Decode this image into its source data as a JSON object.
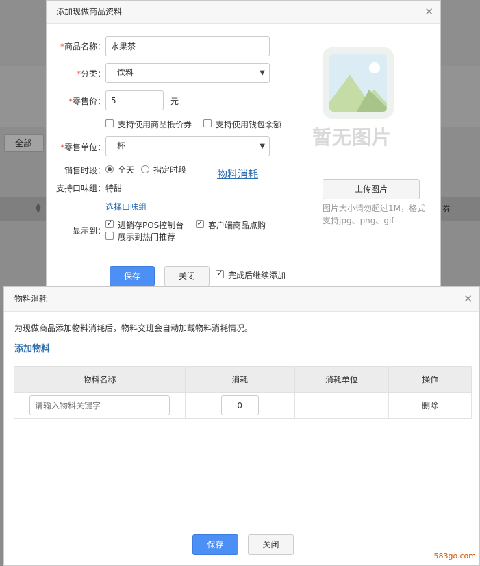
{
  "background": {
    "filter_label": "全部",
    "sort_icon": "sort-icon",
    "column_partial": "券"
  },
  "dialog1": {
    "title": "添加现做商品资料",
    "close_icon": "close-icon",
    "required_mark": "*",
    "name_label": "商品名称：",
    "name_value": "水果茶",
    "category_label": "分类：",
    "category_value": "饮料",
    "price_label": "零售价：",
    "price_value": "5",
    "price_unit": "元",
    "support_voucher": "支持使用商品抵价券",
    "support_wallet": "支持使用钱包余额",
    "unit_label": "零售单位：",
    "unit_value": "杯",
    "sale_time_label": "销售时段：",
    "sale_time_all": "全天",
    "sale_time_custom": "指定时段",
    "material_link": "物料消耗",
    "taste_label": "支持口味组：",
    "taste_value": "特甜",
    "taste_select_link": "选择口味组",
    "display_label": "显示到：",
    "display_pos": "进销存POS控制台",
    "display_client": "客户端商品点购",
    "display_hot": "展示到热门推荐",
    "no_image_text": "暂无图片",
    "upload_button": "上传图片",
    "upload_hint": "图片大小请勿超过1M，格式支持jpg、png、gif",
    "save_button": "保存",
    "close_button": "关闭",
    "continue_add": "完成后继续添加"
  },
  "dialog2": {
    "title": "物料消耗",
    "close_icon": "close-icon",
    "description": "为现做商品添加物料消耗后，物料交班会自动加载物料消耗情况。",
    "add_link": "添加物料",
    "columns": [
      "物料名称",
      "消耗",
      "消耗单位",
      "操作"
    ],
    "row": {
      "name_placeholder": "请输入物料关键字",
      "consume_value": "0",
      "unit": "-",
      "action": "删除"
    },
    "save_button": "保存",
    "close_button": "关闭"
  },
  "watermark": "583go.com"
}
